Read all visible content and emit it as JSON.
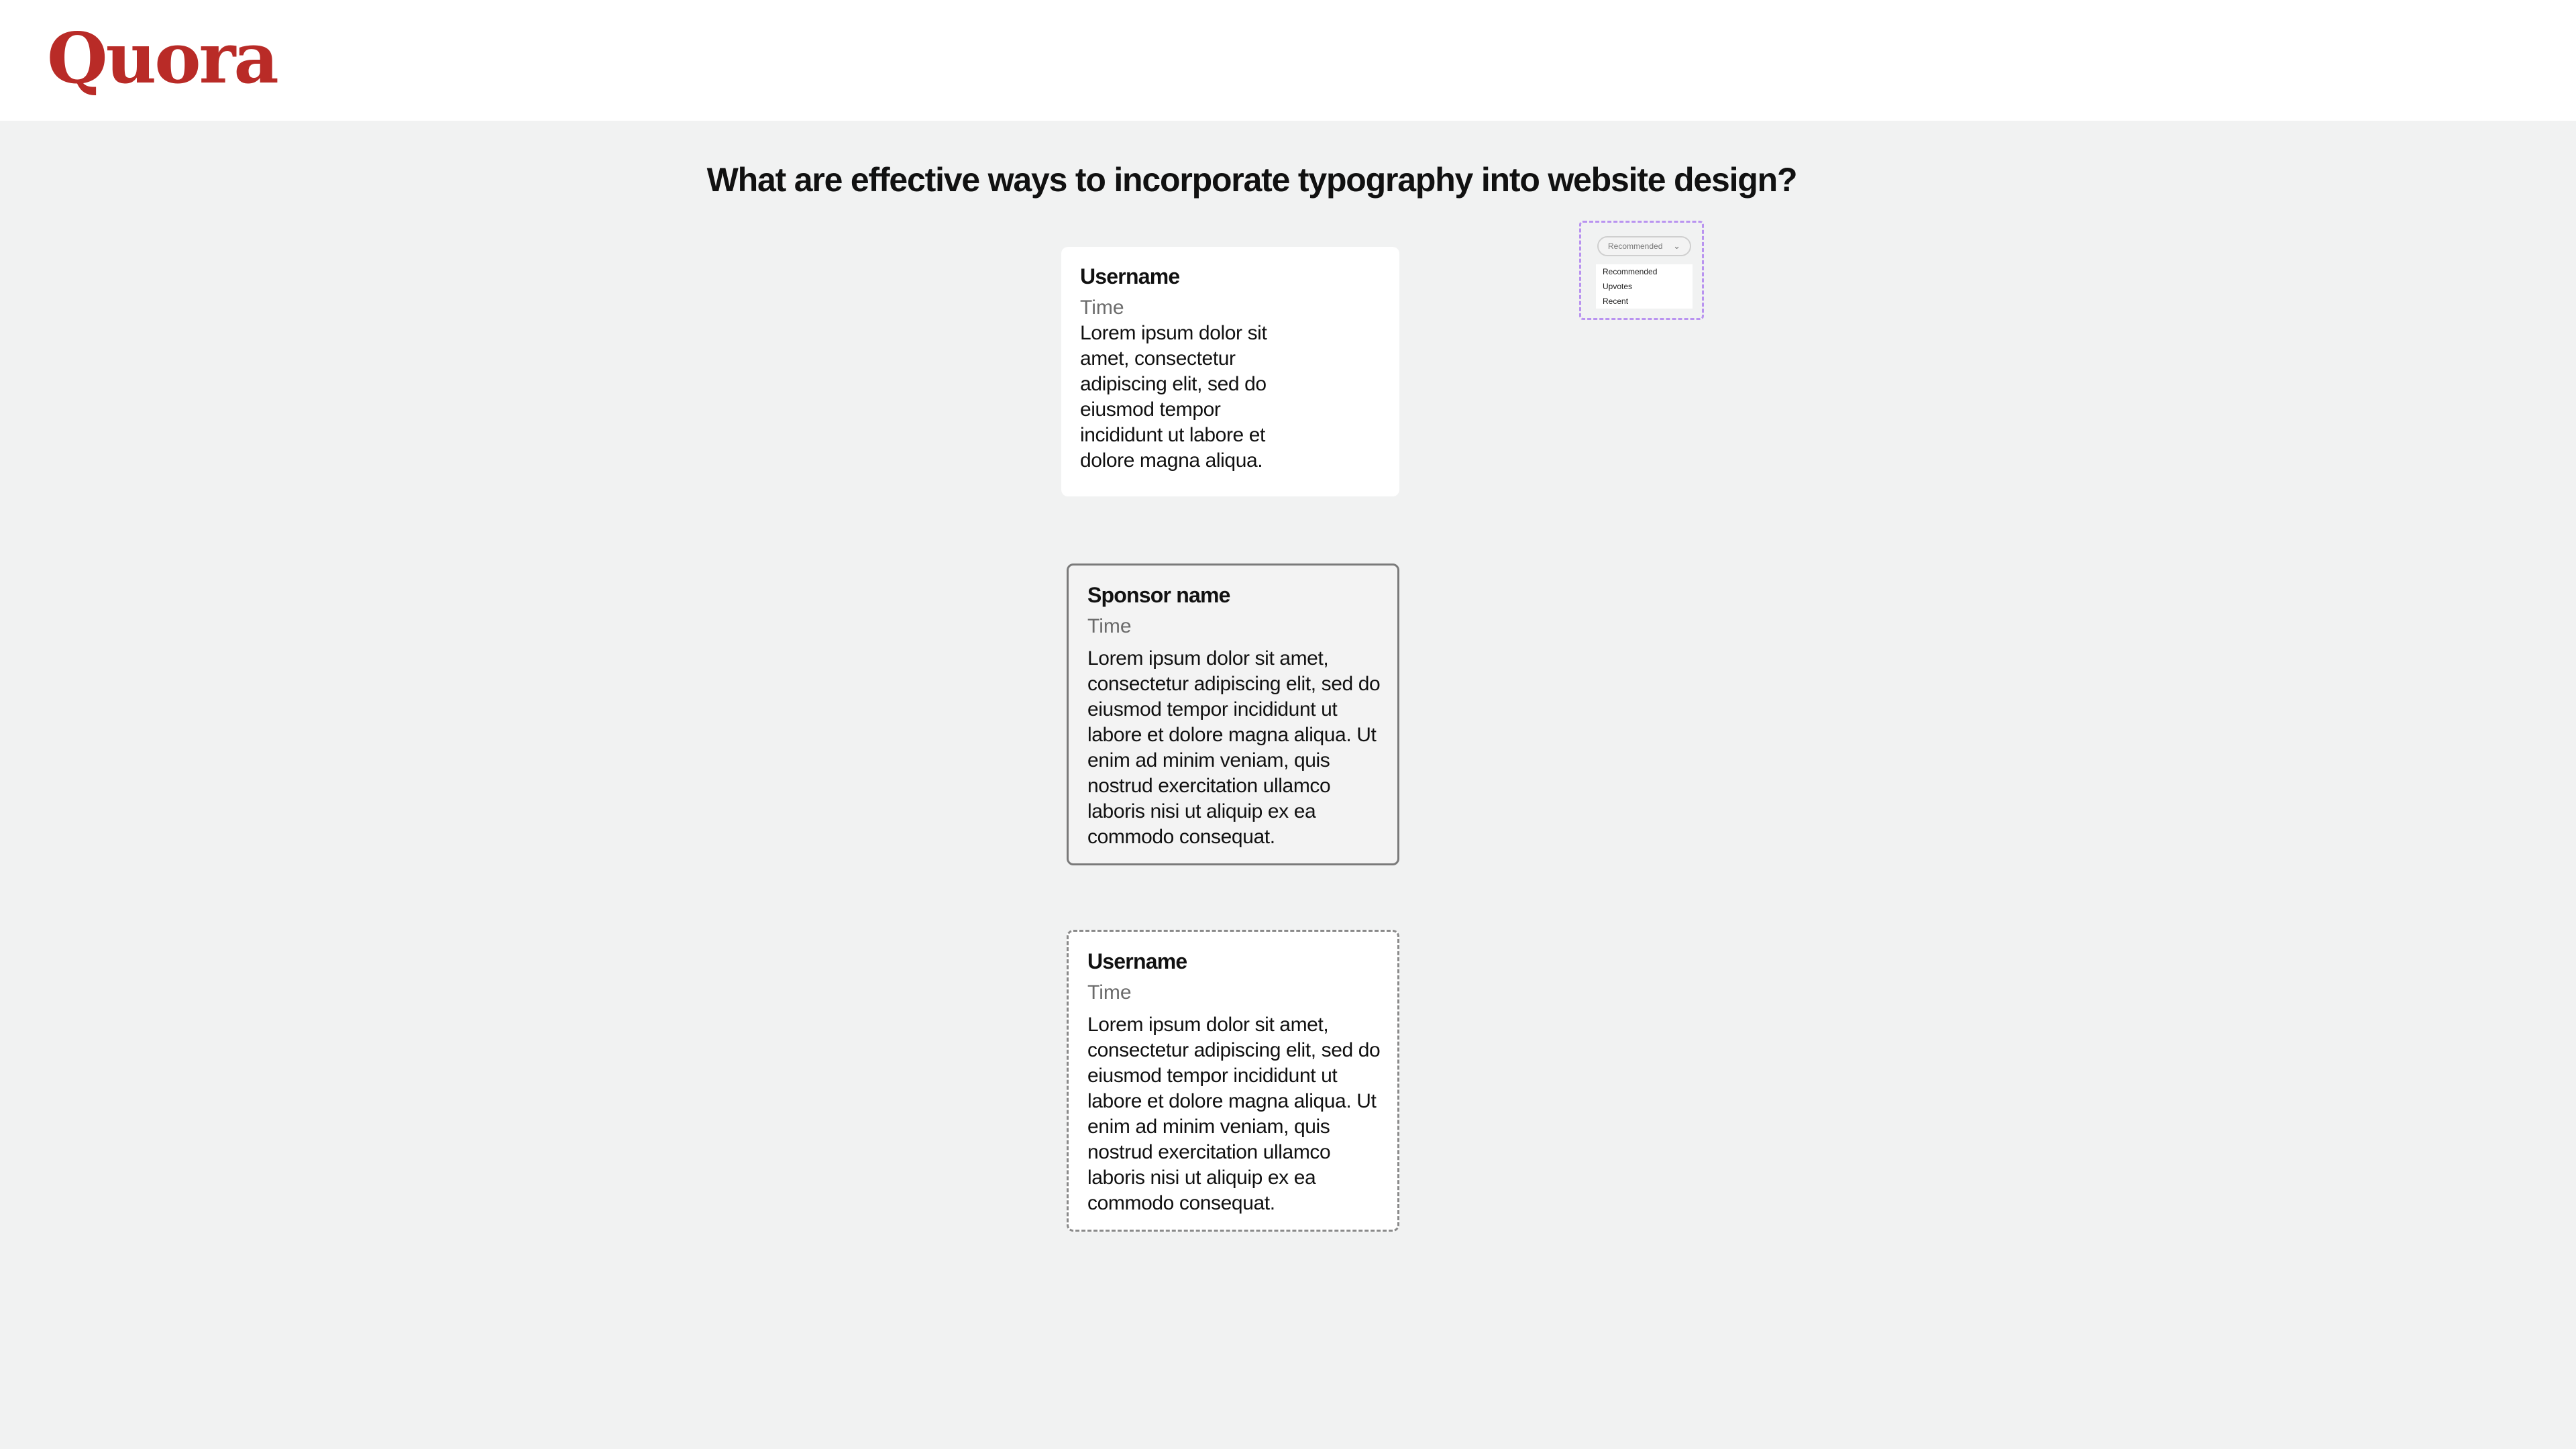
{
  "header": {
    "logo": "Quora"
  },
  "question": {
    "title": "What are effective ways to incorporate typography into website design?"
  },
  "sort": {
    "selected": "Recommended",
    "options": [
      "Recommended",
      "Upvotes",
      "Recent"
    ]
  },
  "answers": [
    {
      "author": "Username",
      "time": "Time",
      "text": "Lorem ipsum dolor sit amet, consectetur adipiscing elit, sed do eiusmod tempor incididunt ut labore et dolore magna aliqua."
    },
    {
      "author": "Sponsor name",
      "time": "Time",
      "text": "Lorem ipsum dolor sit amet, consectetur adipiscing elit, sed do eiusmod tempor incididunt ut labore et dolore magna aliqua. Ut enim ad minim veniam, quis nostrud exercitation ullamco laboris nisi ut aliquip ex ea commodo consequat."
    },
    {
      "author": "Username",
      "time": "Time",
      "text": "Lorem ipsum dolor sit amet, consectetur adipiscing elit, sed do eiusmod tempor incididunt ut labore et dolore magna aliqua. Ut enim ad minim veniam, quis nostrud exercitation ullamco laboris nisi ut aliquip ex ea commodo consequat."
    }
  ]
}
